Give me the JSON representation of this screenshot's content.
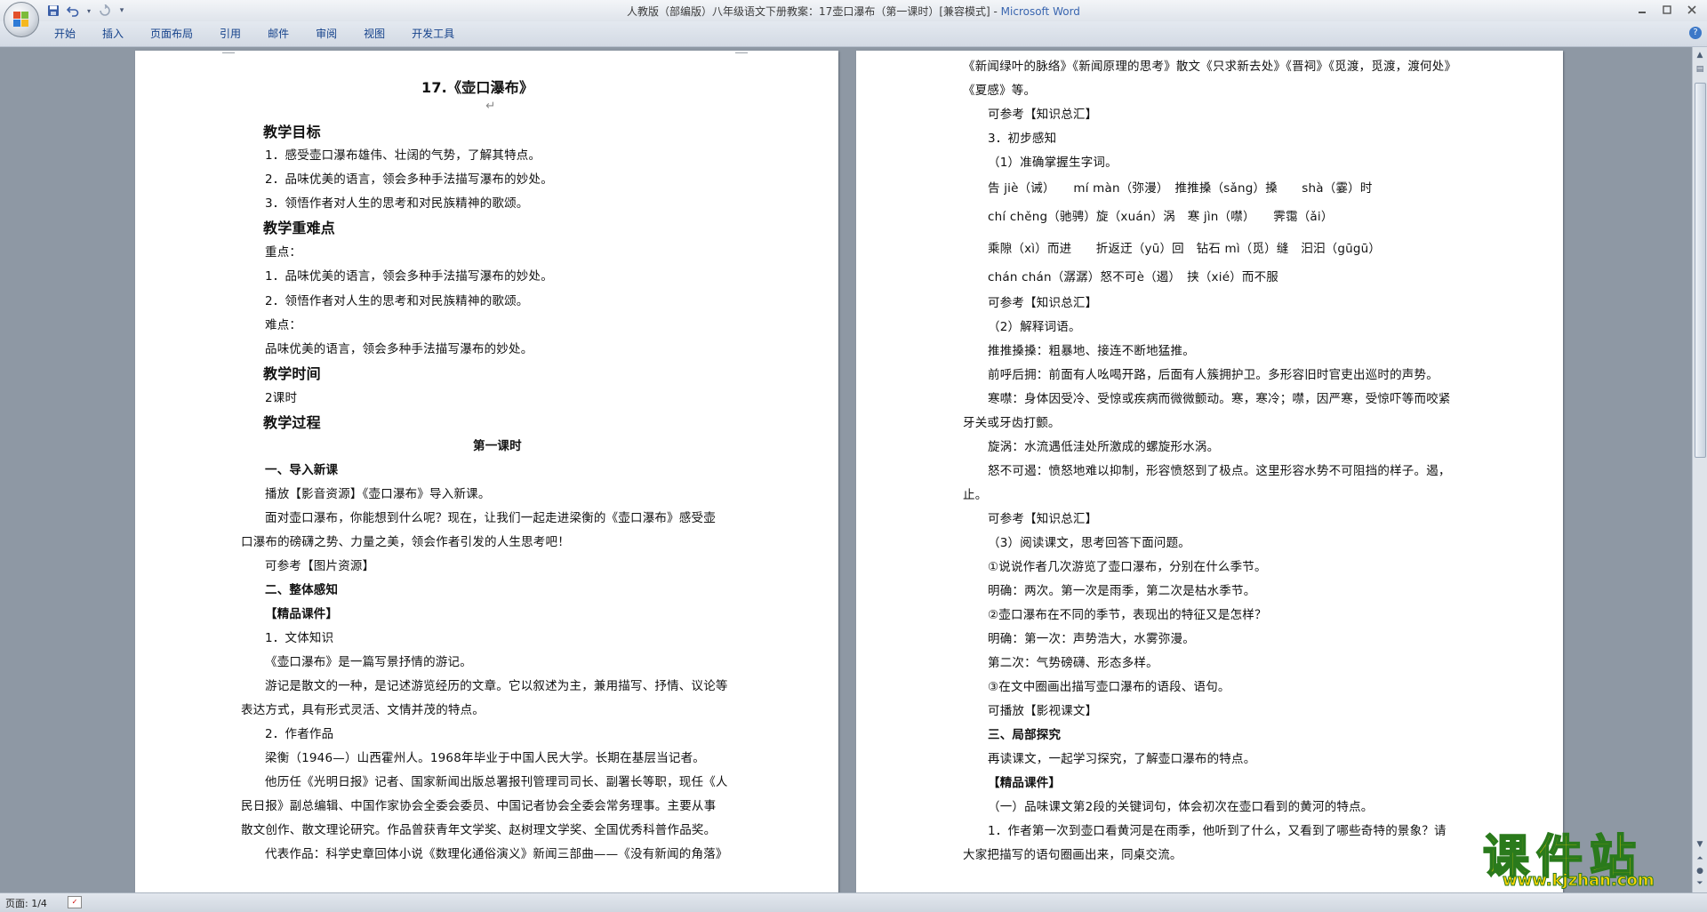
{
  "window": {
    "title": "人教版（部编版）八年级语文下册教案：17壶口瀑布（第一课时）[兼容模式] - Microsoft Word",
    "title_doc": "人教版（部编版）八年级语文下册教案：17壶口瀑布（第一课时）[兼容模式] - ",
    "title_app": "Microsoft Word"
  },
  "qat": {
    "save": "save-icon",
    "undo": "undo-icon",
    "redo": "redo-icon",
    "more": "▾"
  },
  "ribbon": {
    "tabs": [
      "开始",
      "插入",
      "页面布局",
      "引用",
      "邮件",
      "审阅",
      "视图",
      "开发工具"
    ]
  },
  "status": {
    "page": "页面: 1/4"
  },
  "watermark": {
    "main": "课件站",
    "url": "www.kjzhan.com"
  },
  "page1": {
    "lines": [
      "17.《壶口瀑布》",
      "教学目标",
      "1．感受壶口瀑布雄伟、壮阔的气势，了解其特点。",
      "2．品味优美的语言，领会多种手法描写瀑布的妙处。",
      "3．领悟作者对人生的思考和对民族精神的歌颂。",
      "教学重难点",
      "重点：",
      "1．品味优美的语言，领会多种手法描写瀑布的妙处。",
      "2．领悟作者对人生的思考和对民族精神的歌颂。",
      "难点：",
      "品味优美的语言，领会多种手法描写瀑布的妙处。",
      "教学时间",
      "2课时",
      "教学过程",
      "第一课时",
      "一、导入新课",
      "播放【影音资源】《壶口瀑布》导入新课。",
      "面对壶口瀑布，你能想到什么呢？现在，让我们一起走进梁衡的《壶口瀑布》感受壶",
      "口瀑布的磅礴之势、力量之美，领会作者引发的人生思考吧！",
      "可参考【图片资源】",
      "二、整体感知",
      "【精品课件】",
      "1．文体知识",
      "《壶口瀑布》是一篇写景抒情的游记。",
      "游记是散文的一种，是记述游览经历的文章。它以叙述为主，兼用描写、抒情、议论等",
      "表达方式，具有形式灵活、文情并茂的特点。",
      "2．作者作品",
      "梁衡（1946—）山西霍州人。1968年毕业于中国人民大学。长期在基层当记者。",
      "他历任《光明日报》记者、国家新闻出版总署报刊管理司司长、副署长等职，现任《人",
      "民日报》副总编辑、中国作家协会全委会委员、中国记者协会全委会常务理事。主要从事",
      "散文创作、散文理论研究。作品曾获青年文学奖、赵树理文学奖、全国优秀科普作品奖。",
      "代表作品：科学史章回体小说《数理化通俗演义》新闻三部曲——《没有新闻的角落》"
    ]
  },
  "page2": {
    "lines": [
      "《新闻绿叶的脉络》《新闻原理的思考》散文《只求新去处》《晋祠》《觅渡，觅渡，渡何处》",
      "《夏感》等。",
      "可参考【知识总汇】",
      "3．初步感知",
      "（1）准确掌握生字词。",
      "告 jiè（诫）　　mí màn（弥漫）　推推搡（sǎng）搡　　shà（霎）时",
      "chí chěng（驰骋）旋（xuán）涡　寒 jìn（噤）　　霁霭（ǎi）",
      "乘隙（xì）而进　　折返迂（yū）回　钻石 mì（觅）缝　汩汩（gūgū）",
      "chán chán（潺潺）怒不可è（遏）　挟（xié）而不服",
      "可参考【知识总汇】",
      "（2）解释词语。",
      "推推搡搡：粗暴地、接连不断地猛推。",
      "前呼后拥：前面有人吆喝开路，后面有人簇拥护卫。多形容旧时官吏出巡时的声势。",
      "寒噤：身体因受冷、受惊或疾病而微微颤动。寒，寒冷；噤，因严寒，受惊吓等而咬紧",
      "牙关或牙齿打颤。",
      "旋涡：水流遇低洼处所激成的螺旋形水涡。",
      "怒不可遏：愤怒地难以抑制，形容愤怒到了极点。这里形容水势不可阻挡的样子。遏，",
      "止。",
      "可参考【知识总汇】",
      "（3）阅读课文，思考回答下面问题。",
      "①说说作者几次游览了壶口瀑布，分别在什么季节。",
      "明确：两次。第一次是雨季，第二次是枯水季节。",
      "②壶口瀑布在不同的季节，表现出的特征又是怎样？",
      "明确：第一次：声势浩大，水雾弥漫。",
      "第二次：气势磅礴、形态多样。",
      "③在文中圈画出描写壶口瀑布的语段、语句。",
      "可播放【影视课文】",
      "三、局部探究",
      "再读课文，一起学习探究，了解壶口瀑布的特点。",
      "【精品课件】",
      "（一）品味课文第2段的关键词句，体会初次在壶口看到的黄河的特点。",
      "1．作者第一次到壶口看黄河是在雨季，他听到了什么，又看到了哪些奇特的景象？请",
      "大家把描写的语句圈画出来，同桌交流。"
    ]
  }
}
